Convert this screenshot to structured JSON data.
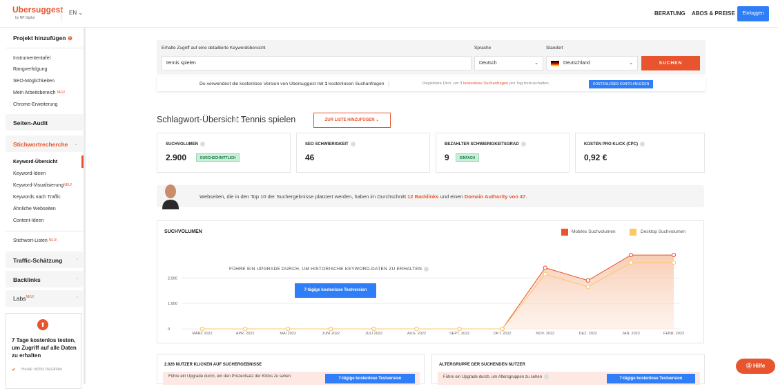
{
  "header": {
    "logo": "Ubersuggest",
    "logo_sub": "by NP digital",
    "lang": "EN ⌄",
    "nav": [
      "BERATUNG",
      "ABOS & PREISE"
    ],
    "login": "Einloggen"
  },
  "sidebar": {
    "add_project": "Projekt hinzufügen",
    "items_top": [
      "Instrumententafel",
      "Rangverfolgung",
      "SEO-Möglichkeiten",
      "Mein Arbeitsbereich",
      "Chrome-Erweiterung"
    ],
    "neu": "NEU!",
    "site_audit": "Seiten-Audit",
    "keyword_research": "Stichwortrecherche",
    "items_kw": [
      "Keyword-Übersicht",
      "Keyword-Ideen",
      "Keyword-Visualisierung",
      "Keywords nach Traffic",
      "Ähnliche Webseiten",
      "Content-Ideen"
    ],
    "lists": "Stichwort-Listen",
    "traffic": "Traffic-Schätzung",
    "backlinks": "Backlinks",
    "labs": "Labs",
    "upgrade_text": "7 Tage kostenlos testen, um Zugriff auf alle Daten zu erhalten",
    "upgrade_note": "Heute nichts bezahlen"
  },
  "search": {
    "label": "Erhalte Zugriff auf eine detaillierte Keywordübersicht",
    "value": "tennis spielen",
    "lang_label": "Sprache",
    "lang_value": "Deutsch",
    "loc_label": "Standort",
    "loc_value": "Deutschland",
    "button": "SUCHEN"
  },
  "notice": {
    "text_pre": "Du verwendest die kostenlose Version von Ubersuggest mit ",
    "count": "1",
    "text_post": " kostenlosen Suchanfragen",
    "sep": "|",
    "reg_pre": "Registriere Dich, um ",
    "reg_hl": "3 kostenlose Suchanfragen",
    "reg_post": " pro Tag freizuschalten.",
    "button": "KOSTENLOSES KONTO ANLEGEN"
  },
  "overview": {
    "title": "Schlagwort-Übersicht :",
    "keyword": "Tennis spielen",
    "add_list": "ZUR LISTE HINZUFÜGEN ⌄"
  },
  "metrics": [
    {
      "label": "SUCHVOLUMEN",
      "value": "2.900",
      "badge": "DURCHSCHNITTLICH"
    },
    {
      "label": "SEO SCHWIERIGKEIT",
      "value": "46",
      "badge": ""
    },
    {
      "label": "BEZAHLTER SCHWIERIGKEITSGRAD",
      "value": "9",
      "badge": "EINFACH"
    },
    {
      "label": "KOSTEN PRO KLICK (CPC)",
      "value": "0,92 €",
      "badge": ""
    }
  ],
  "backlinks": {
    "pre": "Webseiten, die in den Top 10 der Suchergebnisse platziert werden, haben im Durchschnitt ",
    "b1": "12 Backlinks",
    "mid": " und einen ",
    "b2": "Domain Authority von 47",
    "post": "."
  },
  "chart": {
    "title": "SUCHVOLUMEN",
    "legend_mobile": "Mobiles Suchvolumen",
    "legend_desktop": "Desktop Suchvolumen",
    "upgrade": "FÜHRE EIN UPGRADE DURCH, UM HISTORISCHE KEYWORD-DATEN ZU ERHALTEN",
    "trial": "7-tägige kostenlose Testversion",
    "colors": {
      "mobile": "#e8542d",
      "desktop": "#fbc866"
    }
  },
  "chart_data": {
    "type": "line",
    "categories": [
      "MÄRZ 2022",
      "APR. 2022",
      "MAI 2022",
      "JUNI 2022",
      "JULI 2022",
      "AUG. 2022",
      "SEPT. 2022",
      "OKT. 2022",
      "NOV. 2022",
      "DEZ. 2022",
      "JAN. 2023",
      "FEBR. 2023"
    ],
    "yticks": [
      "0",
      "1.000",
      "2.000"
    ],
    "ylim": [
      0,
      3200
    ],
    "series": [
      {
        "name": "Mobiles Suchvolumen",
        "values": [
          0,
          0,
          0,
          0,
          0,
          0,
          0,
          0,
          2400,
          1900,
          2900,
          2900
        ]
      },
      {
        "name": "Desktop Suchvolumen",
        "values": [
          0,
          0,
          0,
          0,
          0,
          0,
          0,
          0,
          2150,
          1650,
          2600,
          2600
        ]
      }
    ]
  },
  "bottom": {
    "left_title": "2.026 NUTZER KLICKEN AUF SUCHERGEBNISSE",
    "left_msg": "Führe ein Upgrade durch, um den Prozentsatz der Klicks zu sehen",
    "right_title": "ALTERGRUPPE DER SUCHENDEN NUTZER",
    "right_msg": "Führe ein Upgrade durch, um Altersgruppen zu sehen",
    "button": "7-tägige kostenlose Testversion"
  },
  "help": "⓪ Hilfe"
}
